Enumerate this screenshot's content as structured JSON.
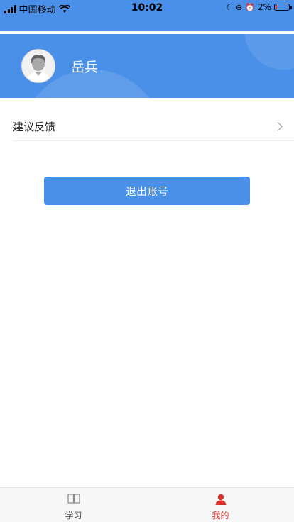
{
  "status_bar": {
    "carrier": "中国移动",
    "time": "10:02",
    "battery_percent": "2%"
  },
  "profile": {
    "username": "岳兵"
  },
  "menu": {
    "items": [
      {
        "label": "建议反馈"
      }
    ]
  },
  "actions": {
    "logout_label": "退出账号"
  },
  "tab_bar": {
    "tabs": [
      {
        "label": "学习",
        "icon": "book-icon",
        "active": false
      },
      {
        "label": "我的",
        "icon": "user-icon",
        "active": true
      }
    ]
  },
  "colors": {
    "primary": "#4a8fe8",
    "active_tab": "#d9342b",
    "inactive_tab": "#888888"
  }
}
